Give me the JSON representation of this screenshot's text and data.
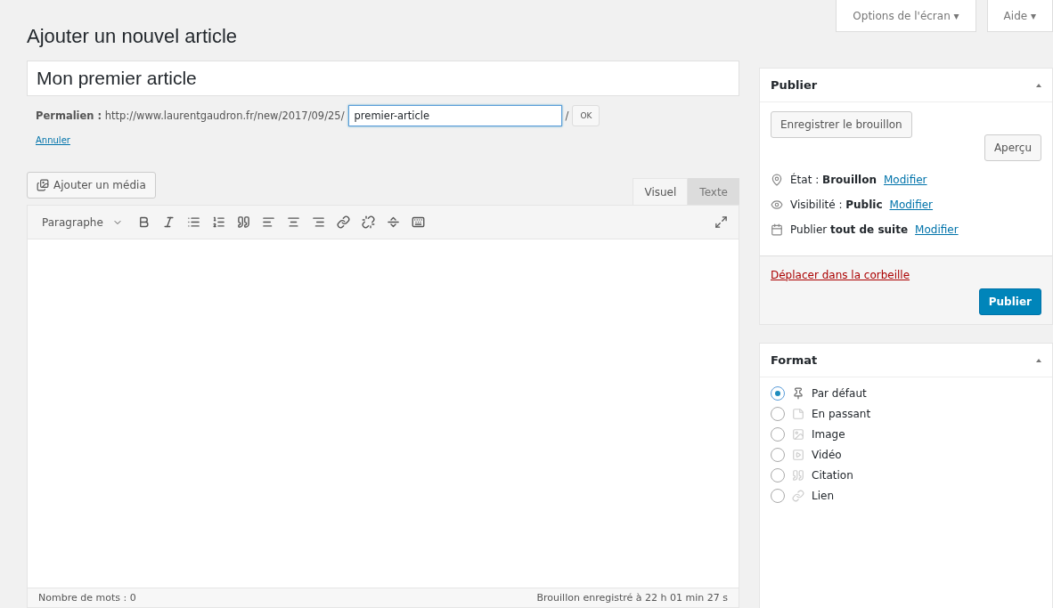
{
  "screen_options": [
    {
      "label": "Options de l'écran ▾"
    },
    {
      "label": "Aide ▾"
    }
  ],
  "page_title": "Ajouter un nouvel article",
  "title_field": {
    "value": "Mon premier article"
  },
  "permalink": {
    "label": "Permalien :",
    "base": "http://www.laurentgaudron.fr/new/2017/09/25/",
    "slug": "premier-article",
    "suffix": "/",
    "ok": "OK",
    "cancel": "Annuler"
  },
  "add_media": "Ajouter un média",
  "editor_tabs": [
    {
      "label": "Visuel",
      "selected": true
    },
    {
      "label": "Texte",
      "selected": false
    }
  ],
  "format_select": "Paragraphe",
  "status_bar": {
    "word_count": "Nombre de mots : 0",
    "saved": "Brouillon enregistré à 22 h 01 min 27 s"
  },
  "publish_box": {
    "title": "Publier",
    "save_draft": "Enregistrer le brouillon",
    "preview": "Aperçu",
    "rows": [
      {
        "kind": "status",
        "text": "État : **Brouillon**",
        "link": "Modifier"
      },
      {
        "kind": "visibility",
        "text": "Visibilité : **Public**",
        "link": "Modifier"
      },
      {
        "kind": "schedule",
        "text": "Publier **tout de suite**",
        "link": "Modifier"
      }
    ],
    "trash": "Déplacer dans la corbeille",
    "publish": "Publier"
  },
  "format_box": {
    "title": "Format",
    "options": [
      {
        "kind": "standard",
        "label": "Par défaut",
        "selected": true
      },
      {
        "kind": "aside",
        "label": "En passant",
        "selected": false
      },
      {
        "kind": "image",
        "label": "Image",
        "selected": false
      },
      {
        "kind": "video",
        "label": "Vidéo",
        "selected": false
      },
      {
        "kind": "quote",
        "label": "Citation",
        "selected": false
      },
      {
        "kind": "link",
        "label": "Lien",
        "selected": false
      }
    ]
  }
}
